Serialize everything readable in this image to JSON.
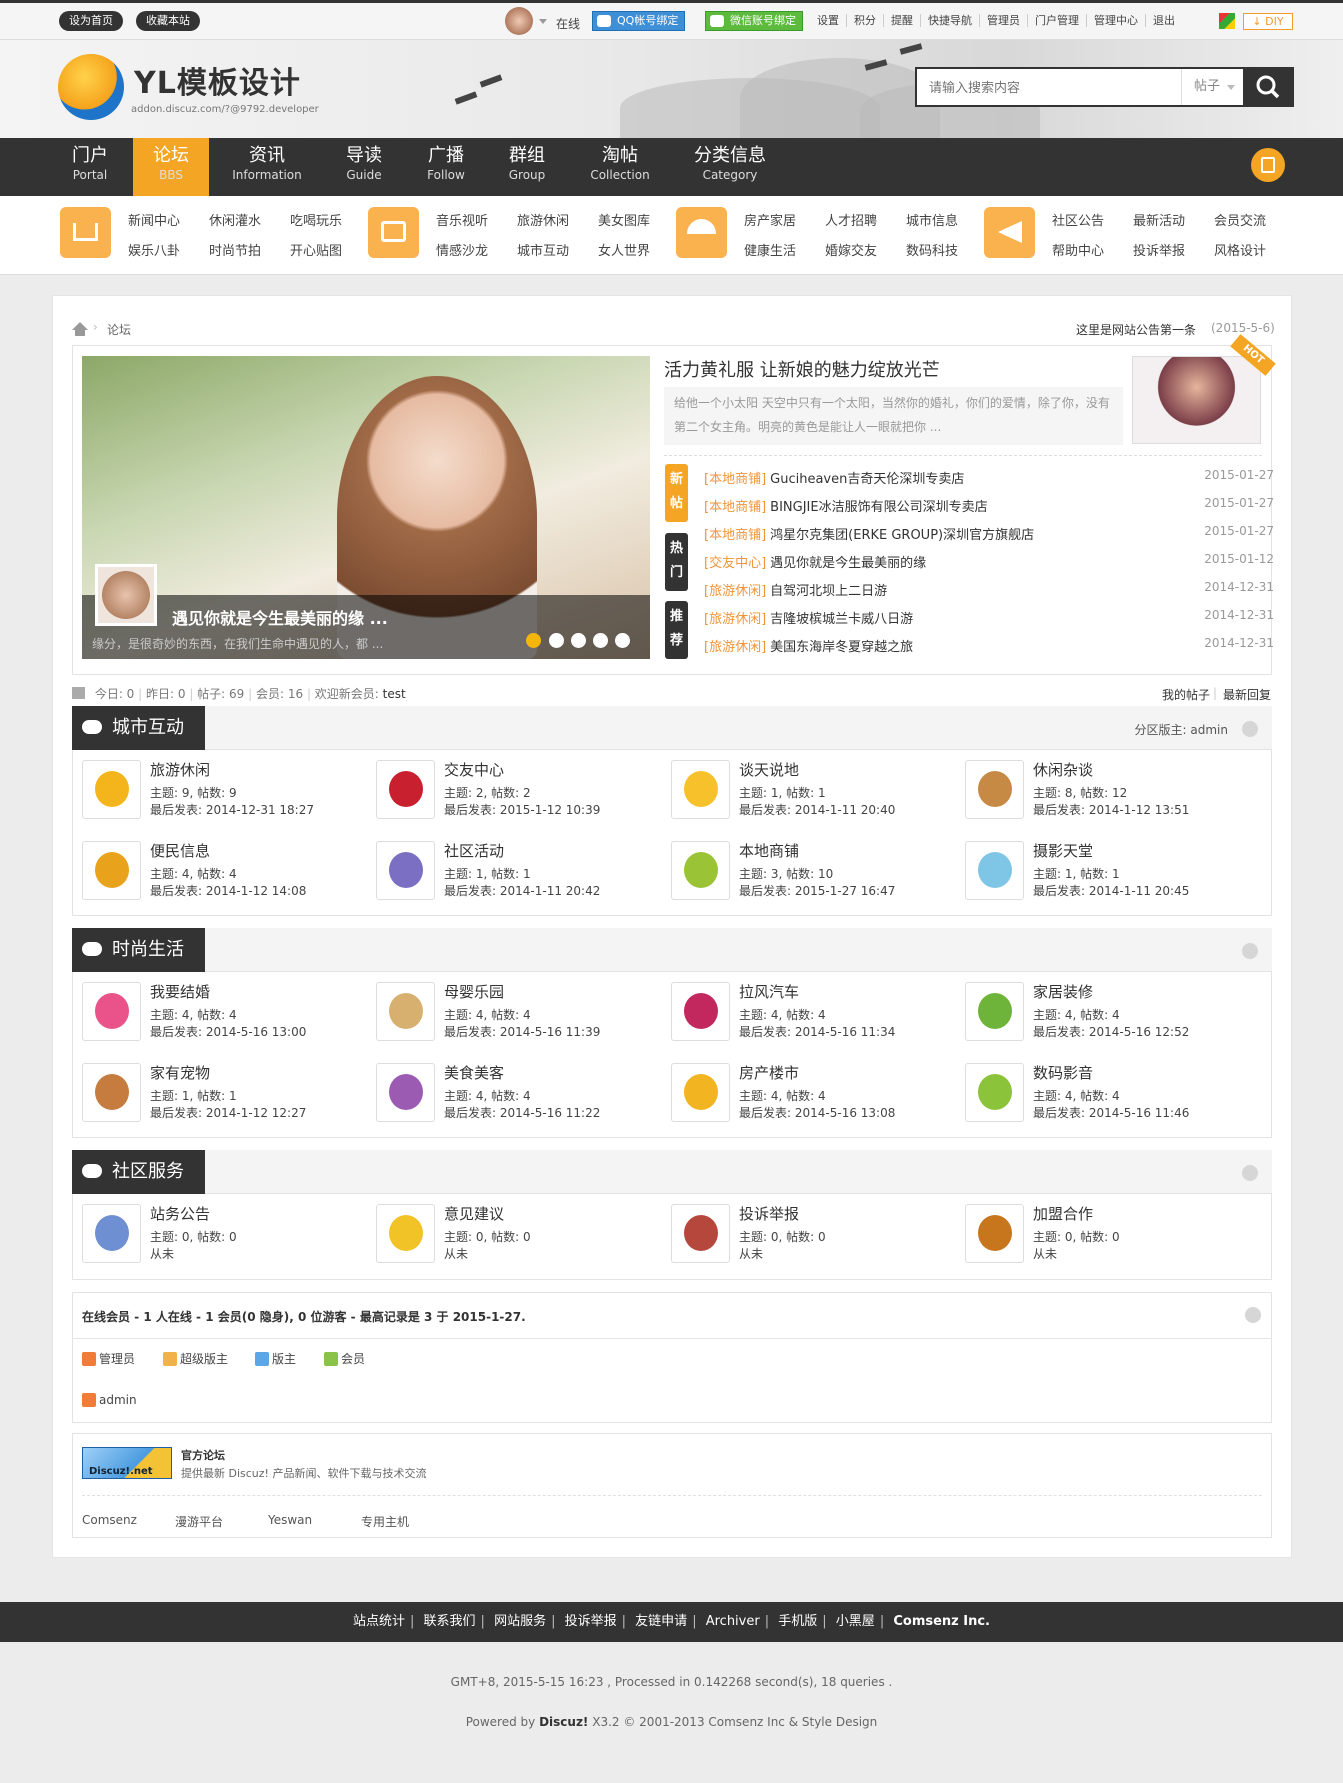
{
  "topbar": {
    "set_home": "设为首页",
    "bookmark": "收藏本站",
    "online": "在线",
    "qq_bind": "QQ帐号绑定",
    "wechat_bind": "微信账号绑定",
    "links": [
      "设置",
      "积分",
      "提醒",
      "快捷导航",
      "管理员",
      "门户管理",
      "管理中心",
      "退出"
    ],
    "diy": "DIY"
  },
  "header": {
    "logo_text": "YL模板设计",
    "logo_sub": "addon.discuz.com/?@9792.developer",
    "search_placeholder": "请输入搜索内容",
    "search_scope": "帖子"
  },
  "nav": [
    {
      "cn": "门户",
      "en": "Portal"
    },
    {
      "cn": "论坛",
      "en": "BBS",
      "active": true
    },
    {
      "cn": "资讯",
      "en": "Information"
    },
    {
      "cn": "导读",
      "en": "Guide"
    },
    {
      "cn": "广播",
      "en": "Follow"
    },
    {
      "cn": "群组",
      "en": "Group"
    },
    {
      "cn": "淘帖",
      "en": "Collection"
    },
    {
      "cn": "分类信息",
      "en": "Category"
    }
  ],
  "subnav": {
    "group1": [
      "新闻中心",
      "休闲灌水",
      "吃喝玩乐",
      "娱乐八卦",
      "时尚节拍",
      "开心贴图"
    ],
    "group2": [
      "音乐视听",
      "旅游休闲",
      "美女图库",
      "情感沙龙",
      "城市互动",
      "女人世界"
    ],
    "group3": [
      "房产家居",
      "人才招聘",
      "城市信息",
      "健康生活",
      "婚嫁交友",
      "数码科技"
    ],
    "group4": [
      "社区公告",
      "最新活动",
      "会员交流",
      "帮助中心",
      "投诉举报",
      "风格设计"
    ]
  },
  "breadcrumb": {
    "current": "论坛"
  },
  "announcement": {
    "text": "这里是网站公告第一条",
    "date": "(2015-5-6)"
  },
  "slider": {
    "caption_title": "遇见你就是今生最美丽的缘 ...",
    "caption_desc": "缘分，是很奇妙的东西，在我们生命中遇见的人，都 ..."
  },
  "headline": {
    "title": "活力黄礼服 让新娘的魅力绽放光芒",
    "summary": "给他一个小太阳 天空中只有一个太阳，当然你的婚礼，你们的爱情，除了你，没有第二个女主角。明亮的黄色是能让人一眼就把你 ...",
    "badge": "HOT"
  },
  "tags": [
    "新帖",
    "热门",
    "推荐"
  ],
  "news": [
    {
      "cat": "[本地商铺]",
      "title": "Guciheaven吉奇天伦深圳专卖店",
      "date": "2015-01-27"
    },
    {
      "cat": "[本地商铺]",
      "title": "BINGJIE冰洁服饰有限公司深圳专卖店",
      "date": "2015-01-27"
    },
    {
      "cat": "[本地商铺]",
      "title": "鸿星尔克集团(ERKE GROUP)深圳官方旗舰店",
      "date": "2015-01-27"
    },
    {
      "cat": "[交友中心]",
      "title": "遇见你就是今生最美丽的缘",
      "date": "2015-01-12"
    },
    {
      "cat": "[旅游休闲]",
      "title": "自驾河北坝上二日游",
      "date": "2014-12-31"
    },
    {
      "cat": "[旅游休闲]",
      "title": "吉隆坡槟城兰卡威八日游",
      "date": "2014-12-31"
    },
    {
      "cat": "[旅游休闲]",
      "title": "美国东海岸冬夏穿越之旅",
      "date": "2014-12-31"
    }
  ],
  "stats": {
    "today": "今日: 0",
    "yesterday": "昨日: 0",
    "posts": "帖子: 69",
    "members": "会员: 16",
    "welcome": "欢迎新会员: ",
    "newest": "test",
    "my_posts": "我的帖子",
    "latest_reply": "最新回复"
  },
  "groups": [
    {
      "title": "城市互动",
      "moderator": "分区版主: admin",
      "forums": [
        {
          "name": "旅游休闲",
          "stat": "主题: 9, 帖数: 9",
          "last": "最后发表: 2014-12-31 18:27",
          "color": "#f3b51b"
        },
        {
          "name": "交友中心",
          "stat": "主题: 2, 帖数: 2",
          "last": "最后发表: 2015-1-12 10:39",
          "color": "#c8202f"
        },
        {
          "name": "谈天说地",
          "stat": "主题: 1, 帖数: 1",
          "last": "最后发表: 2014-1-11 20:40",
          "color": "#f6c12a"
        },
        {
          "name": "休闲杂谈",
          "stat": "主题: 8, 帖数: 12",
          "last": "最后发表: 2014-1-12 13:51",
          "color": "#c78a45"
        },
        {
          "name": "便民信息",
          "stat": "主题: 4, 帖数: 4",
          "last": "最后发表: 2014-1-12 14:08",
          "color": "#e8a21c"
        },
        {
          "name": "社区活动",
          "stat": "主题: 1, 帖数: 1",
          "last": "最后发表: 2014-1-11 20:42",
          "color": "#7b6fc4"
        },
        {
          "name": "本地商铺",
          "stat": "主题: 3, 帖数: 10",
          "last": "最后发表: 2015-1-27 16:47",
          "color": "#9ac335"
        },
        {
          "name": "摄影天堂",
          "stat": "主题: 1, 帖数: 1",
          "last": "最后发表: 2014-1-11 20:45",
          "color": "#7fc6e6"
        }
      ]
    },
    {
      "title": "时尚生活",
      "moderator": "",
      "forums": [
        {
          "name": "我要结婚",
          "stat": "主题: 4, 帖数: 4",
          "last": "最后发表: 2014-5-16 13:00",
          "color": "#e9538a"
        },
        {
          "name": "母婴乐园",
          "stat": "主题: 4, 帖数: 4",
          "last": "最后发表: 2014-5-16 11:39",
          "color": "#d7b070"
        },
        {
          "name": "拉风汽车",
          "stat": "主题: 4, 帖数: 4",
          "last": "最后发表: 2014-5-16 11:34",
          "color": "#c2285e"
        },
        {
          "name": "家居装修",
          "stat": "主题: 4, 帖数: 4",
          "last": "最后发表: 2014-5-16 12:52",
          "color": "#6fb43a"
        },
        {
          "name": "家有宠物",
          "stat": "主题: 1, 帖数: 1",
          "last": "最后发表: 2014-1-12 12:27",
          "color": "#c67c3f"
        },
        {
          "name": "美食美客",
          "stat": "主题: 4, 帖数: 4",
          "last": "最后发表: 2014-5-16 11:22",
          "color": "#9b5bb3"
        },
        {
          "name": "房产楼市",
          "stat": "主题: 4, 帖数: 4",
          "last": "最后发表: 2014-5-16 13:08",
          "color": "#f2b420"
        },
        {
          "name": "数码影音",
          "stat": "主题: 4, 帖数: 4",
          "last": "最后发表: 2014-5-16 11:46",
          "color": "#8bc33a"
        }
      ]
    },
    {
      "title": "社区服务",
      "moderator": "",
      "forums": [
        {
          "name": "站务公告",
          "stat": "主题: 0, 帖数: 0",
          "last": "从未",
          "color": "#6e8fd1"
        },
        {
          "name": "意见建议",
          "stat": "主题: 0, 帖数: 0",
          "last": "从未",
          "color": "#f2c327"
        },
        {
          "name": "投诉举报",
          "stat": "主题: 0, 帖数: 0",
          "last": "从未",
          "color": "#b5473d"
        },
        {
          "name": "加盟合作",
          "stat": "主题: 0, 帖数: 0",
          "last": "从未",
          "color": "#c8761e"
        }
      ]
    }
  ],
  "online": {
    "summary": "在线会员 - 1 人在线 - 1 会员(0 隐身), 0 位游客 - 最高记录是 3 于 2015-1-27.",
    "legend": [
      "管理员",
      "超级版主",
      "版主",
      "会员"
    ],
    "users": [
      "admin"
    ]
  },
  "links_block": {
    "official_title": "官方论坛",
    "official_desc": "提供最新 Discuz! 产品新闻、软件下载与技术交流",
    "logo_text": "Discuz!.net",
    "partners": [
      "Comsenz",
      "漫游平台",
      "Yeswan",
      "专用主机"
    ]
  },
  "footer": {
    "links": [
      "站点统计",
      "联系我们",
      "网站服务",
      "投诉举报",
      "友链申请",
      "Archiver",
      "手机版",
      "小黑屋"
    ],
    "company": "Comsenz Inc.",
    "timing": "GMT+8, 2015-5-15 16:23 , Processed in 0.142268 second(s), 18 queries .",
    "powered_prefix": "Powered by ",
    "powered_brand": "Discuz!",
    "powered_suffix": " X3.2 © 2001-2013 Comsenz Inc & Style Design"
  },
  "colors": {
    "accent": "#f5a524",
    "dark": "#333333",
    "category": "#f0953a"
  }
}
